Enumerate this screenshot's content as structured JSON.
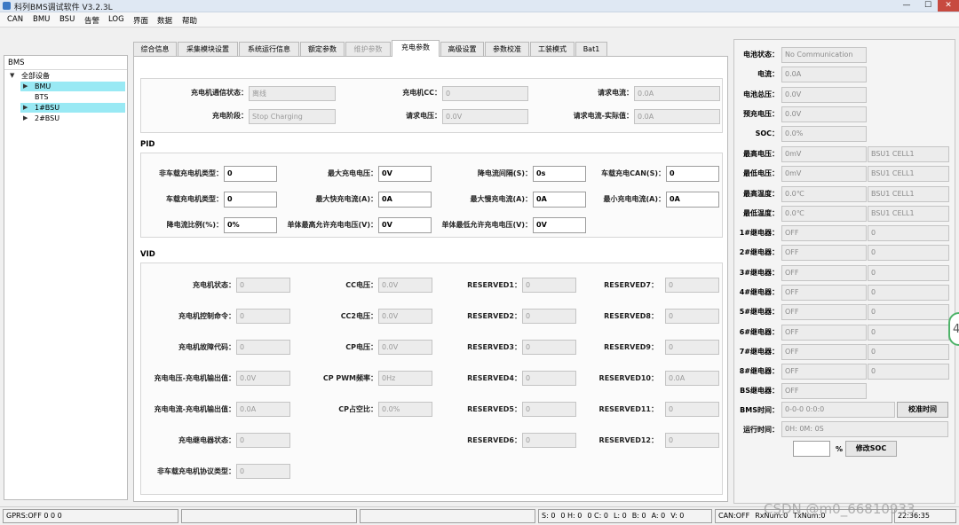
{
  "window": {
    "title": "科列BMS调试软件 V3.2.3L",
    "min": "—",
    "max": "☐",
    "close": "✕"
  },
  "menu": [
    "CAN",
    "BMU",
    "BSU",
    "告警",
    "LOG",
    "界面",
    "数据",
    "帮助"
  ],
  "tree": {
    "title": "BMS",
    "root": "全部设备",
    "items": [
      "BMU",
      "BTS",
      "1#BSU",
      "2#BSU"
    ]
  },
  "tabs": [
    "综合信息",
    "采集模块设置",
    "系统运行信息",
    "额定参数",
    "维护参数",
    "充电参数",
    "高级设置",
    "参数校准",
    "工装模式",
    "Bat1"
  ],
  "top": {
    "labels": [
      "充电机通信状态：",
      "充电机CC：",
      "请求电流：",
      "充电阶段：",
      "请求电压：",
      "请求电流-实际值："
    ],
    "values": [
      "离线",
      "0",
      "0.0A",
      "Stop Charging",
      "0.0V",
      "0.0A"
    ]
  },
  "pid": {
    "title": "PID",
    "labels": [
      "非车载充电机类型：",
      "最大充电电压：",
      "降电流间隔(S)：",
      "车载充电CAN(S)：",
      "车载充电机类型：",
      "最大快充电流(A)：",
      "最大慢充电流(A)：",
      "最小充电电流(A)：",
      "降电流比例(%)：",
      "单体最高允许充电电压(V)：",
      "单体最低允许充电电压(V)："
    ],
    "values": [
      "0",
      "0V",
      "0s",
      "0",
      "0",
      "0A",
      "0A",
      "0A",
      "0%",
      "0V",
      "0V"
    ]
  },
  "vid": {
    "title": "VID",
    "labels": [
      "充电机状态：",
      "CC电压：",
      "RESERVED1：",
      "RESERVED7：",
      "充电机控制命令：",
      "CC2电压：",
      "RESERVED2：",
      "RESERVED8：",
      "充电机故障代码：",
      "CP电压：",
      "RESERVED3：",
      "RESERVED9：",
      "充电电压-充电机输出值：",
      "CP PWM频率：",
      "RESERVED4：",
      "RESERVED10：",
      "充电电流-充电机输出值：",
      "CP占空比：",
      "RESERVED5：",
      "RESERVED11：",
      "充电继电器状态：",
      "RESERVED6：",
      "RESERVED12：",
      "非车载充电机协议类型："
    ],
    "values": [
      "0",
      "0.0V",
      "0",
      "0",
      "0",
      "0.0V",
      "0",
      "0",
      "0",
      "0.0V",
      "0",
      "0",
      "0.0V",
      "0Hz",
      "0",
      "0.0A",
      "0.0A",
      "0.0%",
      "0",
      "0",
      "0",
      "0",
      "0",
      "0"
    ]
  },
  "right": {
    "status": [
      {
        "label": "电池状态：",
        "value": "No Communication"
      },
      {
        "label": "电流：",
        "value": "0.0A"
      },
      {
        "label": "电池总压：",
        "value": "0.0V"
      },
      {
        "label": "预充电压：",
        "value": "0.0V"
      },
      {
        "label": "SOC：",
        "value": "0.0%"
      }
    ],
    "cells": [
      {
        "label": "最高电压：",
        "value": "0mV",
        "pos": "BSU1 CELL1"
      },
      {
        "label": "最低电压：",
        "value": "0mV",
        "pos": "BSU1 CELL1"
      },
      {
        "label": "最高温度：",
        "value": "0.0℃",
        "pos": "BSU1 CELL1"
      },
      {
        "label": "最低温度：",
        "value": "0.0℃",
        "pos": "BSU1 CELL1"
      }
    ],
    "relays": [
      {
        "label": "1#继电器：",
        "value": "OFF",
        "count": "0"
      },
      {
        "label": "2#继电器：",
        "value": "OFF",
        "count": "0"
      },
      {
        "label": "3#继电器：",
        "value": "OFF",
        "count": "0"
      },
      {
        "label": "4#继电器：",
        "value": "OFF",
        "count": "0"
      },
      {
        "label": "5#继电器：",
        "value": "OFF",
        "count": "0"
      },
      {
        "label": "6#继电器：",
        "value": "OFF",
        "count": "0"
      },
      {
        "label": "7#继电器：",
        "value": "OFF",
        "count": "0"
      },
      {
        "label": "8#继电器：",
        "value": "OFF",
        "count": "0"
      },
      {
        "label": "BS继电器：",
        "value": "OFF"
      }
    ],
    "bms_time": {
      "label": "BMS时间：",
      "value": "0-0-0 0:0:0",
      "button": "校准时间"
    },
    "run_time": {
      "label": "运行时间：",
      "value": "0H: 0M: 0S"
    },
    "soc": {
      "input": "",
      "unit": "%",
      "button": "修改SOC"
    }
  },
  "status": {
    "gprs": "GPRS:OFF  0  0  0",
    "counters": [
      "S:  0",
      "0 H:  0",
      "0 C:  0",
      "L:  0",
      "B:  0",
      "A:  0",
      "V:  0"
    ],
    "can": "CAN:OFF",
    "rx": "RxNum:0",
    "tx": "TxNum:0",
    "time": "22:36:35"
  },
  "watermark": "CSDN @m0_66810933",
  "edge_digit": "4"
}
